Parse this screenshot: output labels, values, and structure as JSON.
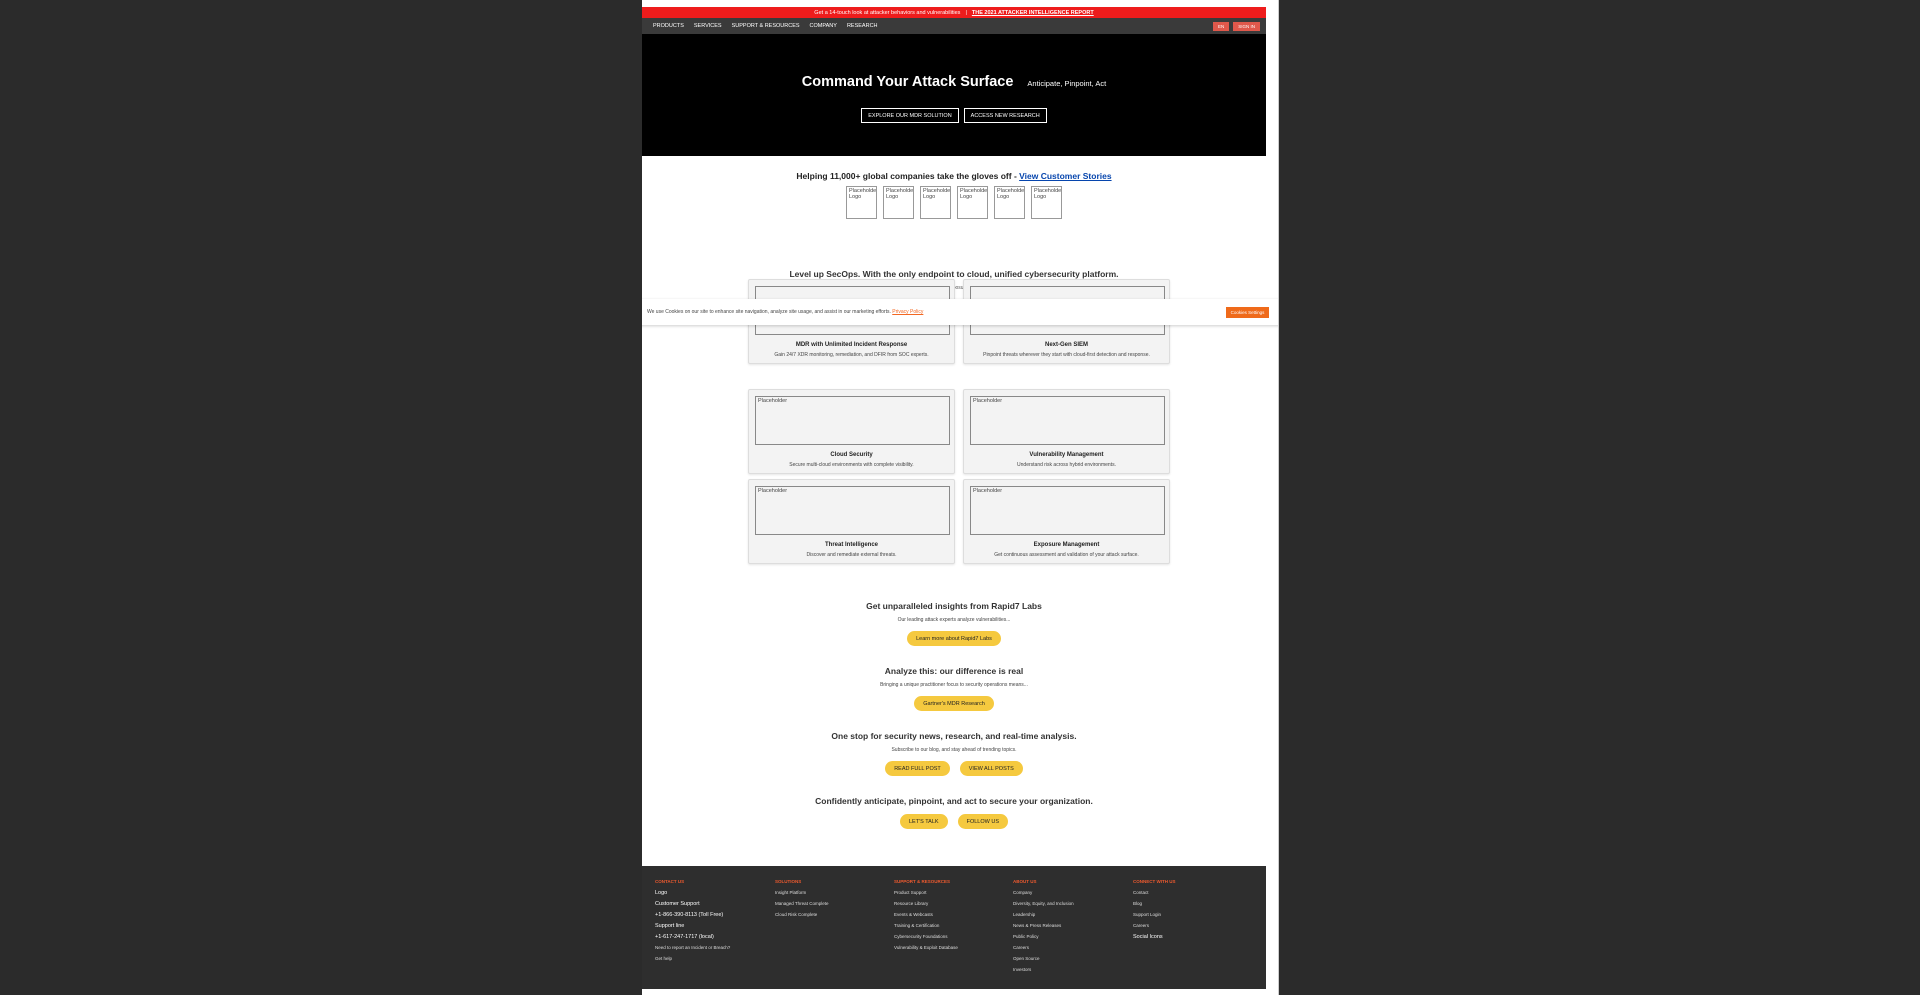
{
  "banner": {
    "text": "Get a 14-touch look at attacker behaviors and vulnerabilities",
    "separator": "|",
    "link": "THE 2021 ATTACKER INTELLIGENCE REPORT"
  },
  "nav": {
    "items": [
      "PRODUCTS",
      "SERVICES",
      "SUPPORT & RESOURCES",
      "COMPANY",
      "RESEARCH"
    ],
    "lang": "EN",
    "signin": "SIGN IN"
  },
  "hero": {
    "title": "Command Your Attack Surface",
    "subtitle": "Anticipate, Pinpoint, Act",
    "btn1": "EXPLORE OUR MDR SOLUTION",
    "btn2": "ACCESS NEW RESEARCH"
  },
  "customers": {
    "text": "Helping 11,000+ global companies take the gloves off - ",
    "link": "View Customer Stories",
    "logos": [
      "Placeholder Logo",
      "Placeholder Logo",
      "Placeholder Logo",
      "Placeholder Logo",
      "Placeholder Logo",
      "Placeholder Logo"
    ]
  },
  "secops": {
    "title": "Level up SecOps. With the only endpoint to cloud, unified cybersecurity platform.",
    "subtitle": "Analyze attack vectors distinct to your organization, link them to exposures, and confidently act to prevent breaches with leading MDR."
  },
  "cookie": {
    "text": "We use Cookies on our site to enhance site navigation, analyze site usage, and assist in our marketing efforts.",
    "link": "Privacy Policy",
    "button": "Cookies Settings"
  },
  "cards": [
    {
      "placeholder": "",
      "title": "MDR with Unlimited Incident Response",
      "desc": "Gain 24/7 XDR monitoring, remediation, and DFIR from SOC experts."
    },
    {
      "placeholder": "",
      "title": "Next-Gen SIEM",
      "desc": "Pinpoint threats wherever they start with cloud-first detection and response."
    },
    {
      "placeholder": "Placeholder",
      "title": "Cloud Security",
      "desc": "Secure multi-cloud environments with complete visibility."
    },
    {
      "placeholder": "Placeholder",
      "title": "Vulnerability Management",
      "desc": "Understand risk across hybrid environments."
    },
    {
      "placeholder": "Placeholder",
      "title": "Threat Intelligence",
      "desc": "Discover and remediate external threats."
    },
    {
      "placeholder": "Placeholder",
      "title": "Exposure Management",
      "desc": "Get continuous assessment and validation of your attack surface."
    }
  ],
  "labs": {
    "title": "Get unparalleled insights from Rapid7 Labs",
    "subtitle": "Our leading attack experts analyze vulnerabilities...",
    "button": "Learn more about Rapid7 Labs"
  },
  "analyze": {
    "title": "Analyze this: our difference is real",
    "subtitle": "Bringing a unique practitioner focus to security operations means...",
    "button": "Gartner's MDR Research"
  },
  "news": {
    "title": "One stop for security news, research, and real-time analysis.",
    "subtitle": "Subscribe to our blog, and stay ahead of trending topics.",
    "btn1": "READ FULL POST",
    "btn2": "VIEW ALL POSTS"
  },
  "cta": {
    "title": "Confidently anticipate, pinpoint, and act to secure your organization.",
    "btn1": "LET'S TALK",
    "btn2": "FOLLOW US"
  },
  "footer": {
    "contact": {
      "head": "CONTACT US",
      "logo": "Logo",
      "support": "Customer Support",
      "phone1": "+1-866-390-8113 (Toll Free)",
      "support_line": "Support line",
      "phone2": "+1-617-247-1717 (local)",
      "breach": "Need to report an Incident or Breach?",
      "help": "Get help"
    },
    "solutions": {
      "head": "SOLUTIONS",
      "links": [
        "Insight Platform",
        "Managed Threat Complete",
        "Cloud Risk Complete"
      ]
    },
    "support": {
      "head": "SUPPORT & RESOURCES",
      "links": [
        "Product Support",
        "Resource Library",
        "Events & Webcasts",
        "Training & Certification",
        "Cybersecurity Foundations",
        "Vulnerability & Exploit Database"
      ]
    },
    "about": {
      "head": "ABOUT US",
      "links": [
        "Company",
        "Diversity, Equity, and Inclusion",
        "Leadership",
        "News & Press Releases",
        "Public Policy",
        "Careers",
        "Open Source",
        "Investors"
      ]
    },
    "connect": {
      "head": "CONNECT WITH US",
      "links": [
        "Contact",
        "Blog",
        "Support Login",
        "Careers"
      ],
      "social": "Social Icons"
    }
  }
}
